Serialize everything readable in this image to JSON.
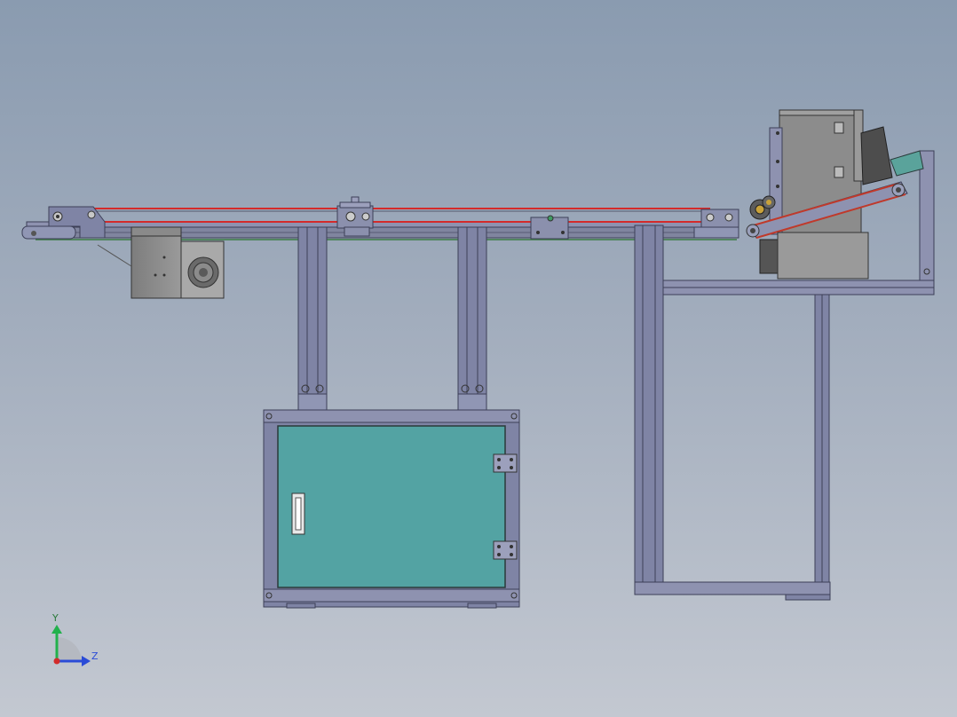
{
  "viewport": {
    "background_top": "#8a9bb0",
    "background_bottom": "#c3c8d1"
  },
  "model": {
    "frame_color": "#7f84a5",
    "frame_edge": "#3c3f57",
    "belt_color": "#d42a2a",
    "door_color": "#53a3a3",
    "panel_gray": "#8c8c8c"
  },
  "triad": {
    "y_label": "Y",
    "z_label": "Z",
    "y_color": "#22b14c",
    "z_color": "#2a4bd7",
    "x_color": "#d22b2b"
  }
}
